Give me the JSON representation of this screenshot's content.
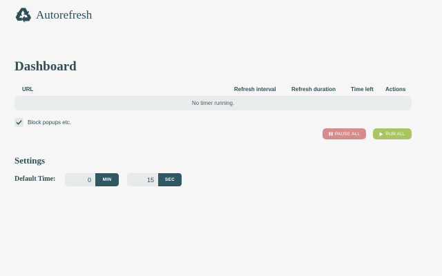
{
  "app": {
    "title": "Autorefresh",
    "logo_icon": "recycle-icon"
  },
  "dashboard": {
    "title": "Dashboard",
    "columns": [
      "URL",
      "Refresh interval",
      "Refresh duration",
      "Time left",
      "Actions"
    ],
    "empty_message": "No timer running.",
    "block_popups": {
      "label": "Block popups etc.",
      "checked": true
    },
    "buttons": {
      "pause_all": {
        "label": "PAUSE ALL",
        "icon": "pause-icon",
        "color": "#d58c8c"
      },
      "run_all": {
        "label": "RUN ALL",
        "icon": "play-icon",
        "color": "#a9c464"
      }
    }
  },
  "settings": {
    "title": "Settings",
    "default_time_label": "Default Time:",
    "minutes": {
      "value": "0",
      "unit": "MIN"
    },
    "seconds": {
      "value": "15",
      "unit": "SEC"
    }
  },
  "colors": {
    "primary": "#2f5862",
    "background": "#f6f6f6",
    "row_bg": "#e9ecec"
  }
}
